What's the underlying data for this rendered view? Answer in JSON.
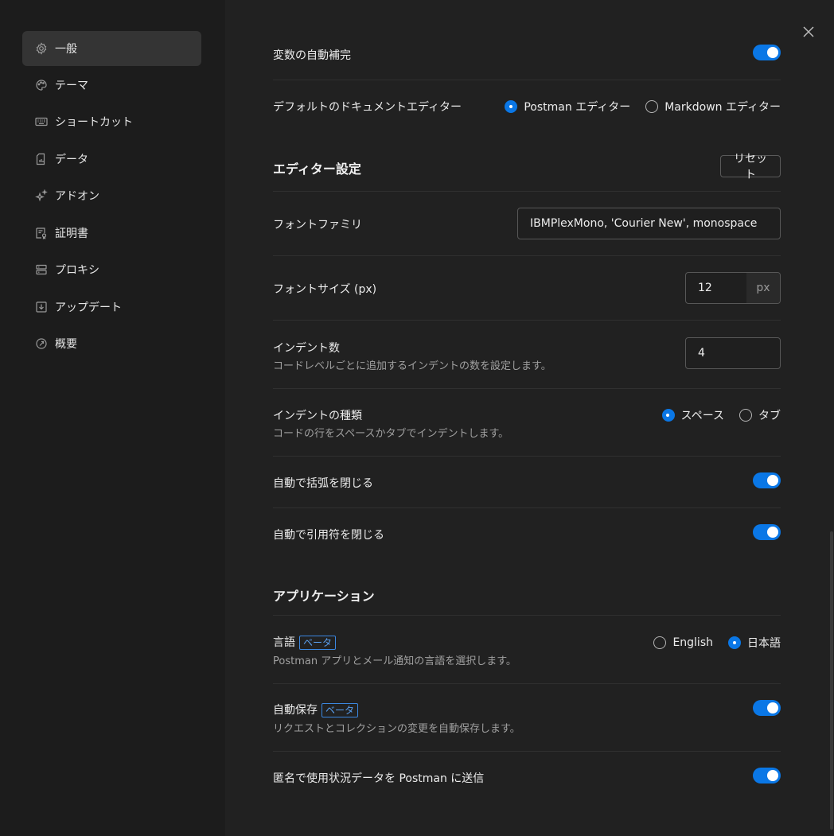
{
  "sidebar": {
    "items": [
      {
        "label": "一般",
        "icon": "gear-icon"
      },
      {
        "label": "テーマ",
        "icon": "palette-icon"
      },
      {
        "label": "ショートカット",
        "icon": "keyboard-icon"
      },
      {
        "label": "データ",
        "icon": "data-file-icon"
      },
      {
        "label": "アドオン",
        "icon": "sparkle-icon"
      },
      {
        "label": "証明書",
        "icon": "certificate-icon"
      },
      {
        "label": "プロキシ",
        "icon": "proxy-server-icon"
      },
      {
        "label": "アップデート",
        "icon": "download-update-icon"
      },
      {
        "label": "概要",
        "icon": "info-circle-icon"
      }
    ],
    "active_index": 0
  },
  "close_icon": "close-icon",
  "settings": {
    "variable_autocomplete": {
      "label": "変数の自動補完",
      "enabled": true
    },
    "default_doc_editor": {
      "label": "デフォルトのドキュメントエディター",
      "options": [
        "Postman エディター",
        "Markdown エディター"
      ],
      "selected": "Postman エディター"
    },
    "editor_section": {
      "title": "エディター設定",
      "reset_label": "リセット"
    },
    "font_family": {
      "label": "フォントファミリ",
      "value": "IBMPlexMono, 'Courier New', monospace"
    },
    "font_size": {
      "label": "フォントサイズ (px)",
      "value": "12",
      "unit": "px"
    },
    "indent_count": {
      "label": "インデント数",
      "description": "コードレベルごとに追加するインデントの数を設定します。",
      "value": "4"
    },
    "indent_type": {
      "label": "インデントの種類",
      "description": "コードの行をスペースかタブでインデントします。",
      "options": [
        "スペース",
        "タブ"
      ],
      "selected": "スペース"
    },
    "auto_close_brackets": {
      "label": "自動で括弧を閉じる",
      "enabled": true
    },
    "auto_close_quotes": {
      "label": "自動で引用符を閉じる",
      "enabled": true
    },
    "application_section": {
      "title": "アプリケーション"
    },
    "language": {
      "label": "言語",
      "badge": "ベータ",
      "description": "Postman アプリとメール通知の言語を選択します。",
      "options": [
        "English",
        "日本語"
      ],
      "selected": "日本語"
    },
    "autosave": {
      "label": "自動保存",
      "badge": "ベータ",
      "description": "リクエストとコレクションの変更を自動保存します。",
      "enabled": true
    },
    "send_usage_data": {
      "label": "匿名で使用状況データを Postman に送信",
      "enabled": true
    }
  },
  "colors": {
    "accent": "#0a77e6",
    "background": "#212121",
    "sidebar": "#1c1c1c"
  }
}
